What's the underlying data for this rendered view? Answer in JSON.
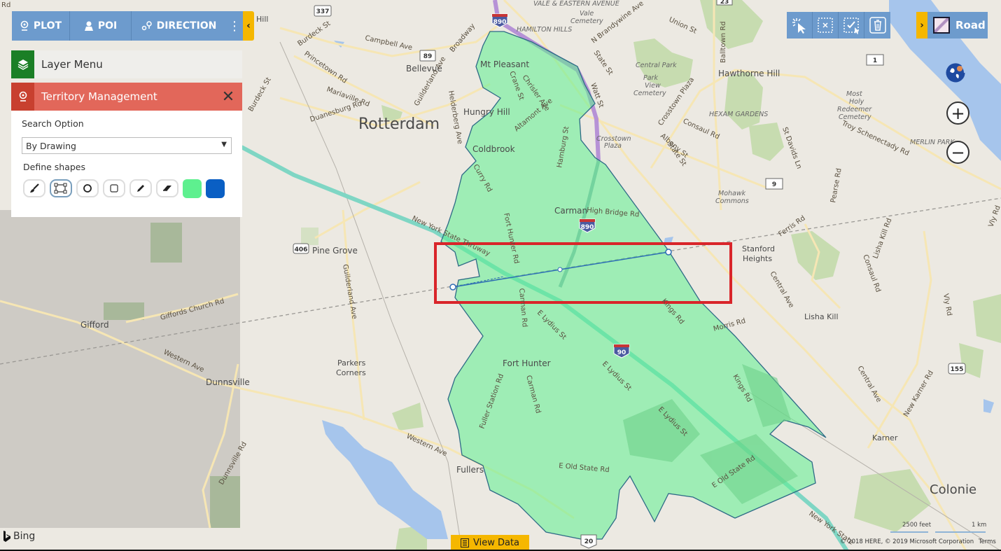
{
  "toolbar": {
    "plot_label": "PLOT",
    "poi_label": "POI",
    "direction_label": "DIRECTION",
    "more_icon": "vertical-ellipsis",
    "collapse_icon": "chevron-left"
  },
  "panel": {
    "layer_menu_label": "Layer Menu",
    "territory_label": "Territory Management",
    "search_option_label": "Search Option",
    "search_option_value": "By Drawing",
    "define_shapes_label": "Define shapes",
    "shape_tools": [
      {
        "name": "brush",
        "icon": "brush-icon"
      },
      {
        "name": "polygon",
        "icon": "polygon-select-icon",
        "selected": true
      },
      {
        "name": "circle",
        "icon": "circle-icon"
      },
      {
        "name": "square",
        "icon": "square-icon"
      },
      {
        "name": "pencil",
        "icon": "pencil-icon"
      },
      {
        "name": "eraser",
        "icon": "eraser-icon"
      }
    ],
    "fill_color": "#5ef08f",
    "stroke_color": "#0a5fc4"
  },
  "right_controls": {
    "selection_tools": [
      "select-pointer",
      "clear-selection",
      "confirm-selection",
      "delete"
    ],
    "map_style_label": "Road",
    "zoom_in": "+",
    "zoom_out": "−"
  },
  "bottom": {
    "bing_label": "Bing",
    "view_data_label": "View Data",
    "scale_feet": "2500 feet",
    "scale_km": "1 km",
    "copyright": "© 2018 HERE, © 2019 Microsoft Corporation",
    "terms_label": "Terms"
  },
  "colors": {
    "toolbar_blue": "#6d9bcd",
    "accent_yellow": "#f5b700",
    "layer_green": "#1b7f26",
    "territory_red": "#e2675a",
    "territory_fill": "#5ef08f",
    "highlight_rect": "#d9252a"
  },
  "map": {
    "places": [
      {
        "name": "Rotterdam",
        "size": "large"
      },
      {
        "name": "Colonie",
        "size": "large"
      },
      {
        "name": "Mt Pleasant"
      },
      {
        "name": "Bellevue"
      },
      {
        "name": "Hungry Hill"
      },
      {
        "name": "Coldbrook"
      },
      {
        "name": "Carman"
      },
      {
        "name": "Pine Grove"
      },
      {
        "name": "Gifford"
      },
      {
        "name": "Dunnsville"
      },
      {
        "name": "Parkers"
      },
      {
        "name": "Corners"
      },
      {
        "name": "Fort Hunter"
      },
      {
        "name": "Fullers"
      },
      {
        "name": "Stanford"
      },
      {
        "name": "Heights"
      },
      {
        "name": "Lisha Kill"
      },
      {
        "name": "Karner"
      },
      {
        "name": "Hawthorne Hill"
      },
      {
        "name": "Hill"
      }
    ],
    "areas": [
      "HAMILTON HILLS",
      "HEXAM GARDENS",
      "MERLIN PARK",
      "VALE & EASTERN AVENUE"
    ],
    "pois": [
      "Vale",
      "Cemetery",
      "Central Park",
      "Park",
      "View",
      "Cemetery",
      "Most",
      "Holy",
      "Redeemer",
      "Cemetery",
      "Mohawk",
      "Commons",
      "Crosstown",
      "Plaza"
    ],
    "roads": {
      "campbell": "Campbell Ave",
      "burdeck1": "Burdeck St",
      "burdeck2": "Burdeck St",
      "princetown": "Princetown Rd",
      "mariaville": "Mariaville Rd",
      "duanesburg": "Duanesburg Rd",
      "guilderland1": "Guilderland Ave",
      "guilderland2": "Guilderland Ave",
      "helderberg": "Helderberg Ave",
      "broadway": "Broadway",
      "crane": "Crane St",
      "chrisler": "Chrisler Ave",
      "altamont": "Altamont Ave",
      "watt": "Watt St",
      "state1": "State St",
      "state2": "State St",
      "nbrandywine": "N Brandywine Ave",
      "union": "Union St",
      "balltown": "Balltown Rd",
      "crosstown": "Crosstown Plaza",
      "consaul1": "Consaul Rd",
      "consaul2": "Consaul Rd",
      "troy": "Troy Schenectady Rd",
      "stdavids": "St Davids Ln",
      "pearse": "Pearse Rd",
      "albany": "Albany St",
      "hamburg": "Hamburg St",
      "curry": "Curry Rd",
      "forthunter": "Fort Hunter Rd",
      "highbridge": "High Bridge Rd",
      "thruway1": "New York State Thruway",
      "thruway2": "New York State",
      "carman1": "Carman Rd",
      "carman2": "Carman Rd",
      "elydius1": "E Lydius St",
      "elydius2": "E Lydius St",
      "elydius3": "E Lydius St",
      "kings1": "Kings Rd",
      "kings2": "Kings Rd",
      "morris": "Morris Rd",
      "ferris": "Ferris Rd",
      "central1": "Central Ave",
      "central2": "Central Ave",
      "lishakill": "Lisha Kill Rd",
      "vly1": "Vly Rd",
      "vly2": "Vly Rd",
      "newkarner": "New Karner Rd",
      "fullerstation": "Fuller Station Rd",
      "eoldstate1": "E Old State Rd",
      "eoldstate2": "E Old State Rd",
      "western1": "Western Ave",
      "western2": "Western Ave",
      "giffords": "Giffords Church Rd",
      "dunnsville": "Dunnsville Rd",
      "mariavilleRd": "Rd"
    },
    "shields": {
      "r337": "337",
      "r89": "89",
      "r23": "23",
      "r1": "1",
      "r9": "9",
      "r406": "406",
      "r155": "155",
      "r20": "20",
      "i890a": "890",
      "i890b": "890",
      "i90": "90"
    }
  }
}
